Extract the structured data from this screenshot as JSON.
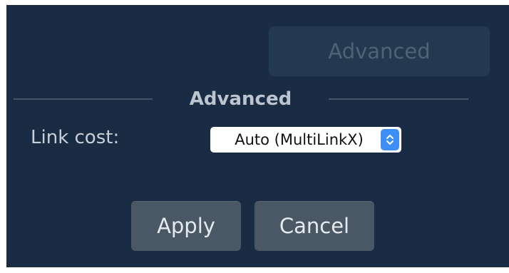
{
  "header": {
    "advanced_button_label": "Advanced"
  },
  "section": {
    "title": "Advanced"
  },
  "link_cost": {
    "label": "Link cost:",
    "selected_value": "Auto (MultiLinkX)"
  },
  "actions": {
    "apply_label": "Apply",
    "cancel_label": "Cancel"
  },
  "colors": {
    "panel_background": "#1a2c44",
    "button_background": "#4a5865",
    "select_accent": "#3d8ff5"
  },
  "icons": {
    "select_stepper": "up-down-chevron-icon"
  }
}
